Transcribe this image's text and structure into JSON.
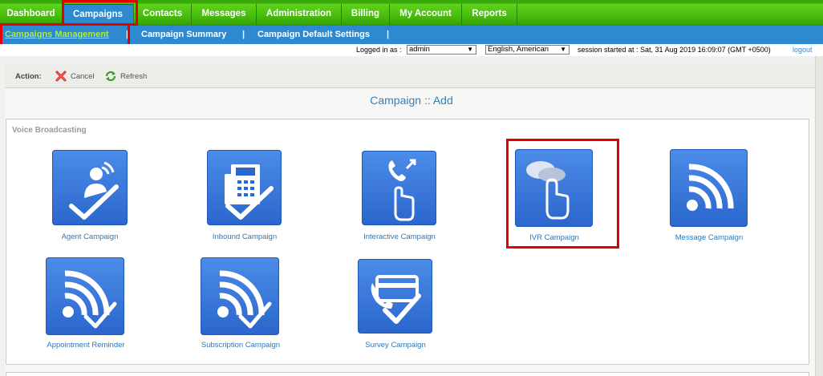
{
  "nav": {
    "items": [
      {
        "label": "Dashboard"
      },
      {
        "label": "Campaigns"
      },
      {
        "label": "Contacts"
      },
      {
        "label": "Messages"
      },
      {
        "label": "Administration"
      },
      {
        "label": "Billing"
      },
      {
        "label": "My Account"
      },
      {
        "label": "Reports"
      }
    ],
    "active_index": 1
  },
  "subnav": {
    "items": [
      {
        "label": "Campaigns Management"
      },
      {
        "label": "Campaign Summary"
      },
      {
        "label": "Campaign Default Settings"
      }
    ],
    "separator": "|"
  },
  "session": {
    "logged_in_label": "Logged in as :",
    "user_value": "admin",
    "language_value": "English, American",
    "session_text": "session started at : Sat, 31 Aug 2019 16:09:07 (GMT +0500)",
    "logout_label": "logout"
  },
  "actions": {
    "label": "Action:",
    "cancel_label": "Cancel",
    "refresh_label": "Refresh"
  },
  "page": {
    "title": "Campaign :: Add",
    "section_title": "Voice Broadcasting"
  },
  "tiles": [
    {
      "label": "Agent Campaign",
      "icon": "agent-check-icon"
    },
    {
      "label": "Inbound Campaign",
      "icon": "phone-check-icon"
    },
    {
      "label": "Interactive Campaign",
      "icon": "phone-finger-icon"
    },
    {
      "label": "IVR Campaign",
      "icon": "speech-finger-icon"
    },
    {
      "label": "Message Campaign",
      "icon": "signal-icon"
    },
    {
      "label": "Appointment Reminder",
      "icon": "signal-check-icon"
    },
    {
      "label": "Subscription Campaign",
      "icon": "signal-check-icon"
    },
    {
      "label": "Survey Campaign",
      "icon": "card-check-icon"
    }
  ],
  "colors": {
    "nav_green": "#4cc00f",
    "nav_active_blue": "#2e8ad0",
    "highlight_red": "#e50000",
    "link_blue": "#2f78b5"
  }
}
